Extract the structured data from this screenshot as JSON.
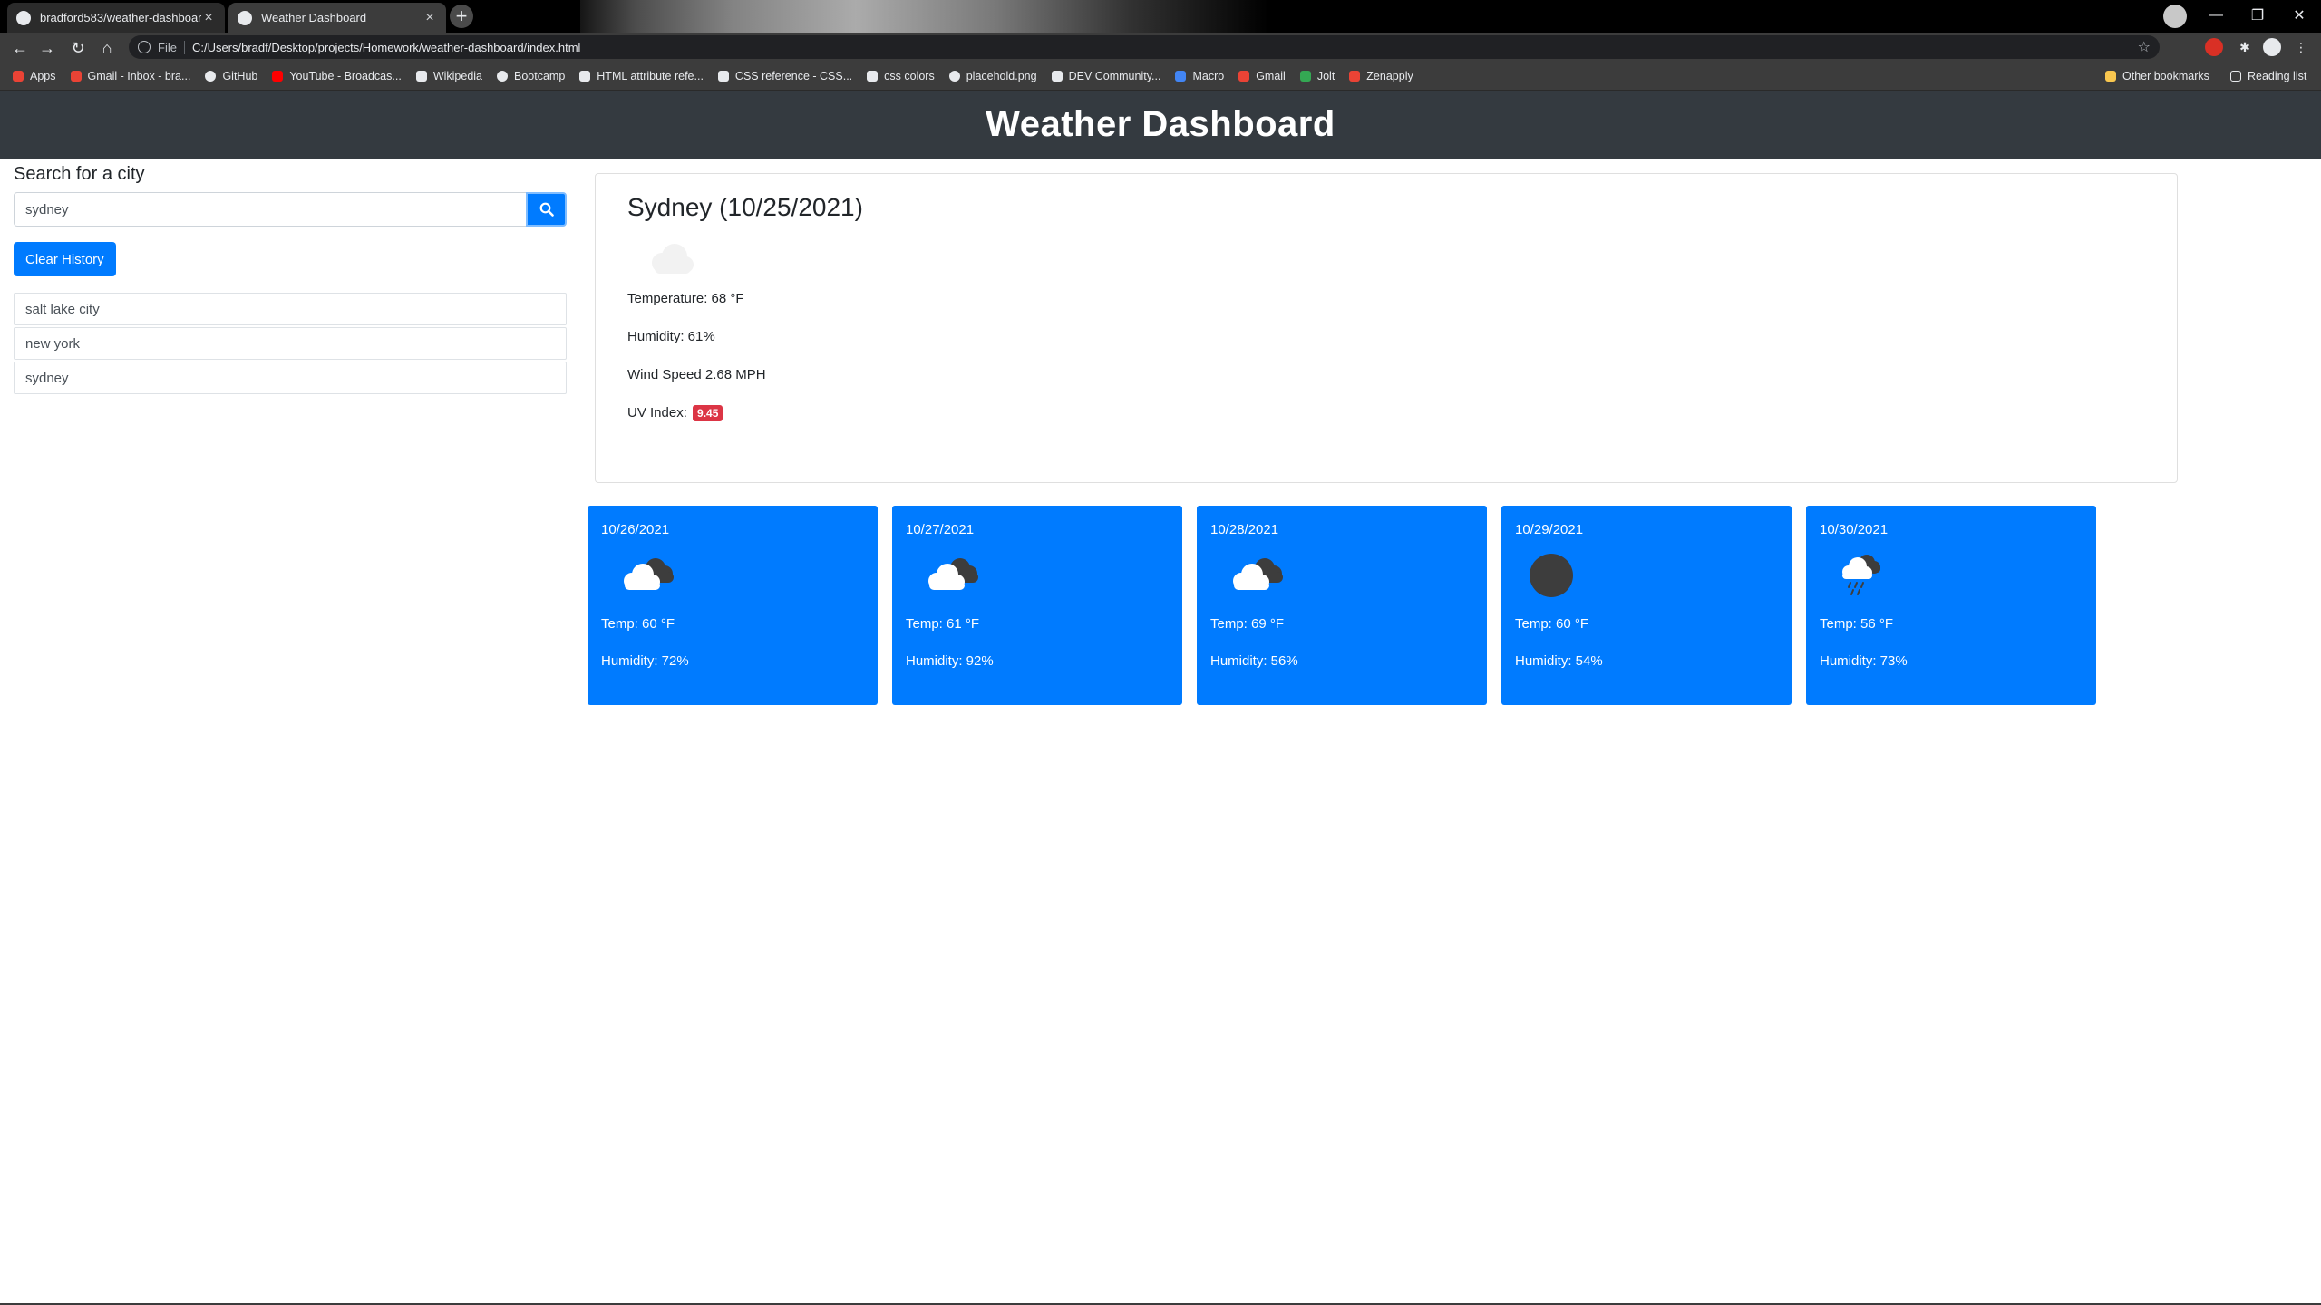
{
  "browser": {
    "tabs": [
      {
        "label": "bradford583/weather-dashboard"
      },
      {
        "label": "Weather Dashboard"
      }
    ],
    "url_scheme": "File",
    "url": "C:/Users/bradf/Desktop/projects/Homework/weather-dashboard/index.html",
    "bookmarks": [
      {
        "label": "Apps",
        "color": "#ea4335"
      },
      {
        "label": "Gmail - Inbox - bra...",
        "color": "#ea4335"
      },
      {
        "label": "GitHub",
        "color": "#e8eaed"
      },
      {
        "label": "YouTube - Broadcas...",
        "color": "#ff0000"
      },
      {
        "label": "Wikipedia",
        "color": "#e8eaed"
      },
      {
        "label": "Bootcamp",
        "color": "#e8eaed"
      },
      {
        "label": "HTML attribute refe...",
        "color": "#e8eaed"
      },
      {
        "label": "CSS reference - CSS...",
        "color": "#e8eaed"
      },
      {
        "label": "css colors",
        "color": "#e8eaed"
      },
      {
        "label": "placehold.png",
        "color": "#e8eaed"
      },
      {
        "label": "DEV Community...",
        "color": "#e8eaed"
      },
      {
        "label": "Macro",
        "color": "#4285f4"
      },
      {
        "label": "Gmail",
        "color": "#ea4335"
      },
      {
        "label": "Jolt",
        "color": "#34a853"
      },
      {
        "label": "Zenapply",
        "color": "#ea4335"
      }
    ],
    "other_bookmarks": "Other bookmarks",
    "reading_list": "Reading list"
  },
  "header": {
    "title": "Weather Dashboard"
  },
  "search": {
    "title": "Search for a city",
    "value": "sydney",
    "clear_label": "Clear History",
    "history": [
      "salt lake city",
      "new york",
      "sydney"
    ]
  },
  "current": {
    "title": "Sydney (10/25/2021)",
    "icon": "cloud-icon",
    "temperature": "Temperature: 68 °F",
    "humidity": "Humidity: 61%",
    "wind": "Wind Speed 2.68 MPH",
    "uv_label": "UV Index:",
    "uv_value": "9.45",
    "uv_color": "#dc3545"
  },
  "forecast": [
    {
      "date": "10/26/2021",
      "icon": "broken-clouds-icon",
      "temp": "Temp: 60 °F",
      "humidity": "Humidity: 72%"
    },
    {
      "date": "10/27/2021",
      "icon": "broken-clouds-icon",
      "temp": "Temp: 61 °F",
      "humidity": "Humidity: 92%"
    },
    {
      "date": "10/28/2021",
      "icon": "broken-clouds-icon",
      "temp": "Temp: 69 °F",
      "humidity": "Humidity: 56%"
    },
    {
      "date": "10/29/2021",
      "icon": "overcast-icon",
      "temp": "Temp: 60 °F",
      "humidity": "Humidity: 54%"
    },
    {
      "date": "10/30/2021",
      "icon": "rain-icon",
      "temp": "Temp: 56 °F",
      "humidity": "Humidity: 73%"
    }
  ],
  "colors": {
    "accent": "#007bff",
    "header_bg": "#343a40"
  }
}
